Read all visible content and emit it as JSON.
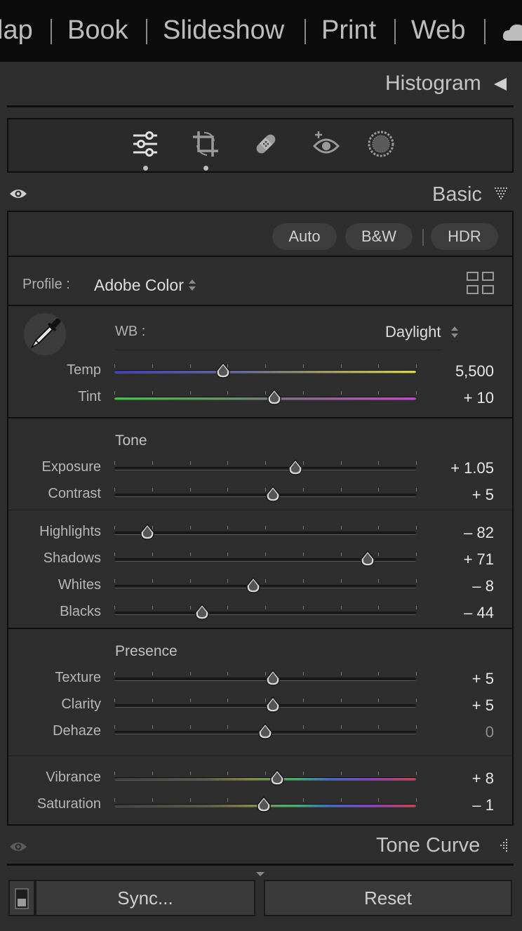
{
  "modules": [
    {
      "label": "lap"
    },
    {
      "label": "Book"
    },
    {
      "label": "Slideshow"
    },
    {
      "label": "Print"
    },
    {
      "label": "Web"
    }
  ],
  "histogram": {
    "title": "Histogram"
  },
  "tools": [
    {
      "name": "basic-adjust-icon",
      "active_dot": true
    },
    {
      "name": "crop-icon",
      "active_dot": true
    },
    {
      "name": "healing-icon",
      "active_dot": false
    },
    {
      "name": "red-eye-icon",
      "active_dot": false
    },
    {
      "name": "masking-icon",
      "active_dot": false
    }
  ],
  "basic": {
    "title": "Basic",
    "auto_label": "Auto",
    "bw_label": "B&W",
    "hdr_label": "HDR",
    "profile_label": "Profile :",
    "profile_value": "Adobe Color",
    "wb_label": "WB :",
    "wb_value": "Daylight"
  },
  "sliders": {
    "temp": {
      "label": "Temp",
      "value": "5,500",
      "position": 0.36
    },
    "tint": {
      "label": "Tint",
      "value": "+ 10",
      "position": 0.53
    },
    "exposure": {
      "label": "Exposure",
      "value": "+ 1.05",
      "position": 0.6
    },
    "contrast": {
      "label": "Contrast",
      "value": "+ 5",
      "position": 0.525
    },
    "highlights": {
      "label": "Highlights",
      "value": "– 82",
      "position": 0.11
    },
    "shadows": {
      "label": "Shadows",
      "value": "+ 71",
      "position": 0.84
    },
    "whites": {
      "label": "Whites",
      "value": "– 8",
      "position": 0.46
    },
    "blacks": {
      "label": "Blacks",
      "value": "– 44",
      "position": 0.29
    },
    "texture": {
      "label": "Texture",
      "value": "+ 5",
      "position": 0.525
    },
    "clarity": {
      "label": "Clarity",
      "value": "+ 5",
      "position": 0.525
    },
    "dehaze": {
      "label": "Dehaze",
      "value": "0",
      "position": 0.5
    },
    "vibrance": {
      "label": "Vibrance",
      "value": "+ 8",
      "position": 0.54
    },
    "saturation": {
      "label": "Saturation",
      "value": "– 1",
      "position": 0.495
    }
  },
  "sections": {
    "tone": "Tone",
    "presence": "Presence"
  },
  "tone_curve": {
    "title": "Tone Curve"
  },
  "footer": {
    "sync_label": "Sync...",
    "reset_label": "Reset"
  }
}
